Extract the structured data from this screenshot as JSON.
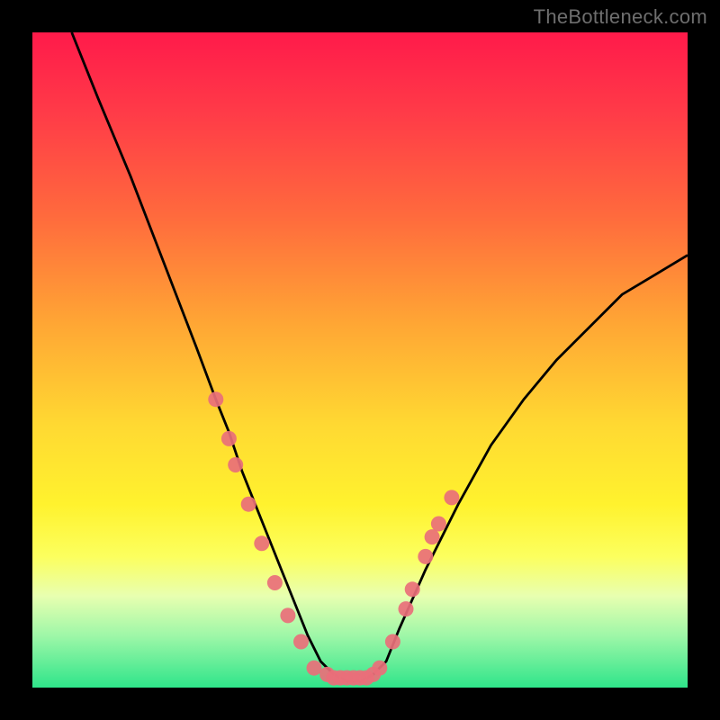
{
  "watermark": "TheBottleneck.com",
  "chart_data": {
    "type": "line",
    "title": "",
    "xlabel": "",
    "ylabel": "",
    "xlim": [
      0,
      100
    ],
    "ylim": [
      0,
      100
    ],
    "series": [
      {
        "name": "bottleneck-curve",
        "x": [
          6,
          10,
          15,
          20,
          25,
          28,
          30,
          32,
          34,
          36,
          38,
          40,
          42,
          44,
          46,
          48,
          50,
          52,
          54,
          56,
          60,
          65,
          70,
          75,
          80,
          85,
          90,
          95,
          100
        ],
        "y": [
          100,
          90,
          78,
          65,
          52,
          44,
          39,
          33,
          28,
          23,
          18,
          13,
          8,
          4,
          2,
          1,
          1,
          2,
          4,
          9,
          18,
          28,
          37,
          44,
          50,
          55,
          60,
          63,
          66
        ]
      }
    ],
    "markers": [
      {
        "x": 28,
        "y": 44
      },
      {
        "x": 30,
        "y": 38
      },
      {
        "x": 31,
        "y": 34
      },
      {
        "x": 33,
        "y": 28
      },
      {
        "x": 35,
        "y": 22
      },
      {
        "x": 37,
        "y": 16
      },
      {
        "x": 39,
        "y": 11
      },
      {
        "x": 41,
        "y": 7
      },
      {
        "x": 43,
        "y": 3
      },
      {
        "x": 45,
        "y": 2
      },
      {
        "x": 46,
        "y": 1.5
      },
      {
        "x": 47,
        "y": 1.5
      },
      {
        "x": 48,
        "y": 1.5
      },
      {
        "x": 49,
        "y": 1.5
      },
      {
        "x": 50,
        "y": 1.5
      },
      {
        "x": 51,
        "y": 1.5
      },
      {
        "x": 52,
        "y": 2
      },
      {
        "x": 53,
        "y": 3
      },
      {
        "x": 55,
        "y": 7
      },
      {
        "x": 57,
        "y": 12
      },
      {
        "x": 58,
        "y": 15
      },
      {
        "x": 60,
        "y": 20
      },
      {
        "x": 61,
        "y": 23
      },
      {
        "x": 62,
        "y": 25
      },
      {
        "x": 64,
        "y": 29
      }
    ],
    "marker_color": "#e96f79",
    "curve_color": "#000000",
    "background_gradient": [
      "#ff1a4a",
      "#ff6a3d",
      "#ffd932",
      "#fcff5e",
      "#2fe58a"
    ]
  }
}
